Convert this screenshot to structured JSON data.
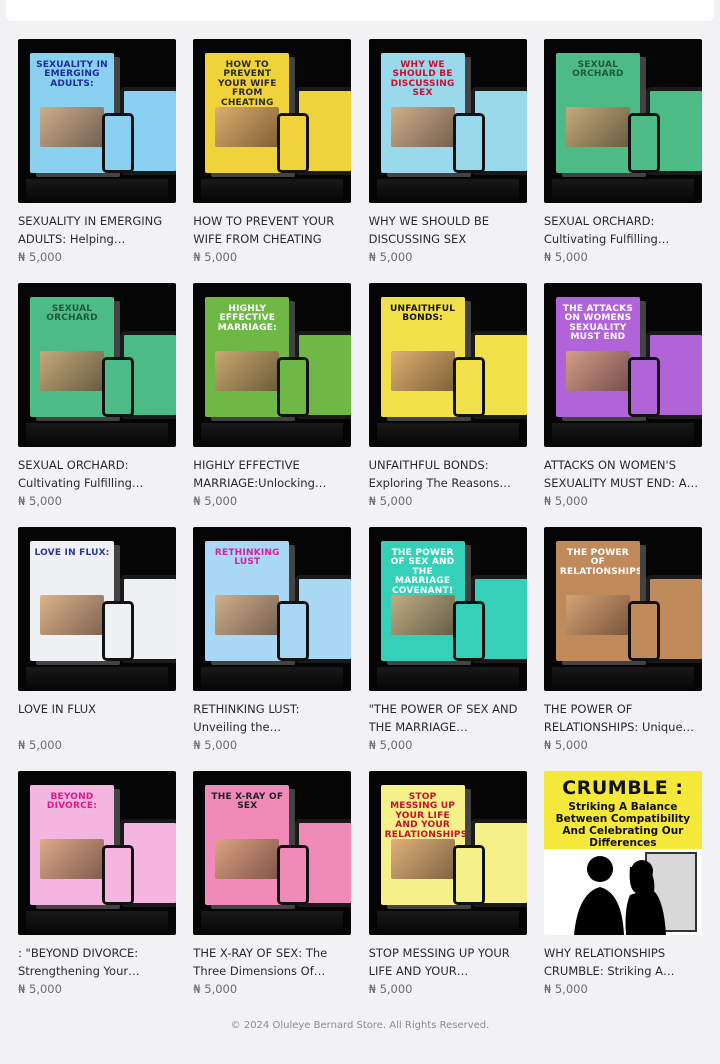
{
  "footer": {
    "copyright": "© 2024 Oluleye Bernard Store. All Rights Reserved."
  },
  "products": [
    {
      "name": "SEXUALITY IN EMERGING ADULTS: Helping Emerging…",
      "price": "₦ 5,000",
      "cover_title": "SEXUALITY IN EMERGING ADULTS:",
      "cover_color": "#8ad0f0",
      "title_color": "#1e2e9a"
    },
    {
      "name": "HOW TO PREVENT YOUR WIFE FROM CHEATING",
      "price": "₦ 5,000",
      "cover_title": "HOW TO PREVENT YOUR WIFE FROM CHEATING",
      "cover_color": "#f0d23a",
      "title_color": "#2a2a2a"
    },
    {
      "name": "WHY WE SHOULD BE DISCUSSING SEX",
      "price": "₦ 5,000",
      "cover_title": "WHY WE SHOULD BE DISCUSSING SEX",
      "cover_color": "#9ad8ec",
      "title_color": "#c8102e"
    },
    {
      "name": "SEXUAL ORCHARD: Cultivating Fulfilling…",
      "price": "₦ 5,000",
      "cover_title": "SEXUAL ORCHARD",
      "cover_color": "#4dbb86",
      "title_color": "#1d5a3a"
    },
    {
      "name": "SEXUAL ORCHARD: Cultivating Fulfilling…",
      "price": "₦ 5,000",
      "cover_title": "SEXUAL ORCHARD",
      "cover_color": "#4dbb86",
      "title_color": "#1d5a3a"
    },
    {
      "name": "HIGHLY EFFECTIVE MARRIAGE:Unlocking The…",
      "price": "₦ 5,000",
      "cover_title": "HIGHLY EFFECTIVE MARRIAGE:",
      "cover_color": "#6fb846",
      "title_color": "#ffffff"
    },
    {
      "name": "UNFAITHFUL BONDS: Exploring The Reasons why…",
      "price": "₦ 5,000",
      "cover_title": "UNFAITHFUL BONDS:",
      "cover_color": "#f2e04a",
      "title_color": "#111111"
    },
    {
      "name": "ATTACKS ON WOMEN'S SEXUALITY MUST END: A C…",
      "price": "₦ 5,000",
      "cover_title": "THE ATTACKS ON WOMENS SEXUALITY MUST END",
      "cover_color": "#b064d8",
      "title_color": "#ffffff"
    },
    {
      "name": "LOVE IN FLUX",
      "price": "₦ 5,000",
      "cover_title": "LOVE IN FLUX:",
      "cover_color": "#eef0f4",
      "title_color": "#2a3a8a"
    },
    {
      "name": "RETHINKING LUST: Unveiling the Consequences of…",
      "price": "₦ 5,000",
      "cover_title": "RETHINKING LUST",
      "cover_color": "#a8d8f4",
      "title_color": "#d8209a"
    },
    {
      "name": "\"THE POWER OF SEX AND THE MARRIAGE COVENANT…",
      "price": "₦ 5,000",
      "cover_title": "THE POWER OF SEX AND THE MARRIAGE COVENANT!",
      "cover_color": "#36d0b8",
      "title_color": "#ffffff"
    },
    {
      "name": "THE POWER OF RELATIONSHIPS: Unique Bu…",
      "price": "₦ 5,000",
      "cover_title": "THE POWER OF RELATIONSHIPS",
      "cover_color": "#c08a5a",
      "title_color": "#ffffff"
    },
    {
      "name": ": \"BEYOND DIVORCE: Strengthening Your…",
      "price": "₦ 5,000",
      "cover_title": "BEYOND DIVORCE:",
      "cover_color": "#f4b6e0",
      "title_color": "#d81a8a"
    },
    {
      "name": "THE X-RAY OF SEX: The Three Dimensions Of Sex,…",
      "price": "₦ 5,000",
      "cover_title": "THE X-RAY OF SEX",
      "cover_color": "#f08ab8",
      "title_color": "#222222"
    },
    {
      "name": "STOP MESSING UP YOUR LIFE AND YOUR…",
      "price": "₦ 5,000",
      "cover_title": "STOP MESSING UP YOUR LIFE AND YOUR RELATIONSHIPS:",
      "cover_color": "#f6f08a",
      "title_color": "#c8102e"
    },
    {
      "name": "WHY RELATIONSHIPS CRUMBLE: Striking A…",
      "price": "₦ 5,000",
      "cover_title": "CRUMBLE :",
      "cover_subtitle": "Striking A Balance Between Compatibility And Celebrating Our Differences",
      "cover_color": "#f4e83a",
      "title_color": "#111111",
      "style": "plain"
    }
  ]
}
